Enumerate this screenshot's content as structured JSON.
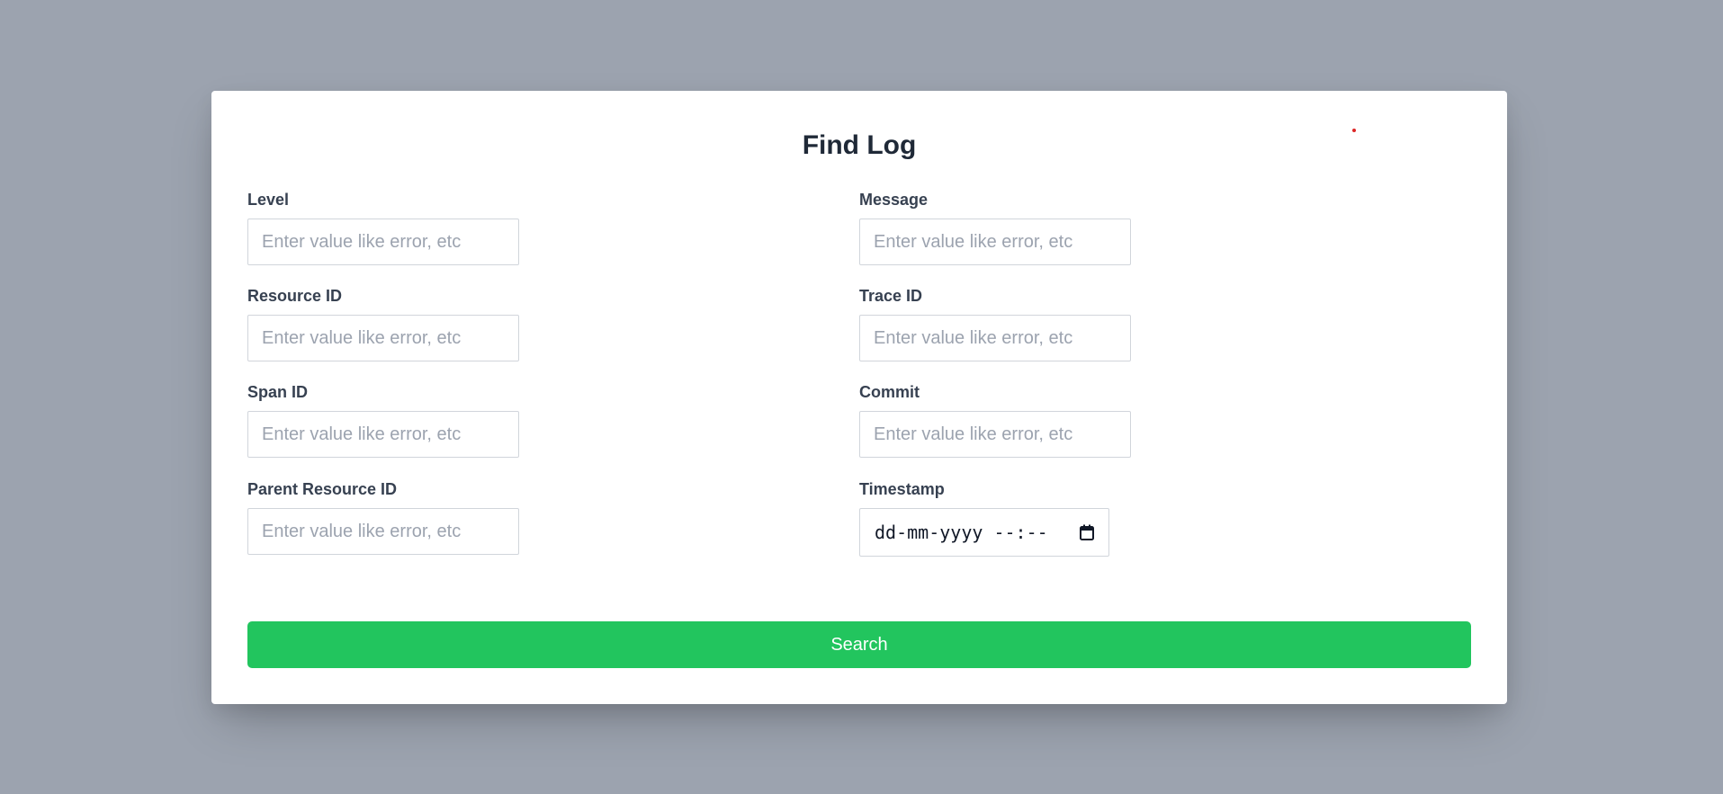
{
  "modal": {
    "title": "Find Log",
    "fields": {
      "level": {
        "label": "Level",
        "placeholder": "Enter value like error, etc",
        "value": ""
      },
      "message": {
        "label": "Message",
        "placeholder": "Enter value like error, etc",
        "value": ""
      },
      "resource_id": {
        "label": "Resource ID",
        "placeholder": "Enter value like error, etc",
        "value": ""
      },
      "trace_id": {
        "label": "Trace ID",
        "placeholder": "Enter value like error, etc",
        "value": ""
      },
      "span_id": {
        "label": "Span ID",
        "placeholder": "Enter value like error, etc",
        "value": ""
      },
      "commit": {
        "label": "Commit",
        "placeholder": "Enter value like error, etc",
        "value": ""
      },
      "parent_resource_id": {
        "label": "Parent Resource ID",
        "placeholder": "Enter value like error, etc",
        "value": ""
      },
      "timestamp": {
        "label": "Timestamp",
        "display_value": "dd-mm-yyyy --:--",
        "icon": "calendar-icon"
      }
    },
    "search_button": {
      "label": "Search"
    }
  },
  "colors": {
    "backdrop": "#9ca3af",
    "modal_bg": "#ffffff",
    "primary_button": "#22c55e",
    "label_text": "#374151",
    "title_text": "#1f2937",
    "placeholder_text": "#9ca3af",
    "indicator_dot": "#dc2626"
  }
}
